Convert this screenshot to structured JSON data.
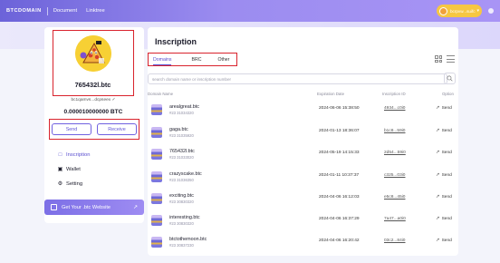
{
  "header": {
    "brand": "BTCDOMAIN",
    "nav": [
      "Document",
      "Linktree"
    ],
    "user_name": "bcrpvw...suifc"
  },
  "profile": {
    "name": "765432l.btc",
    "address": "bc1qamvs...dcpseex  ✓",
    "balance": "0.000010000000 BTC"
  },
  "actions": {
    "send_label": "Send",
    "receive_label": "Receive"
  },
  "menu": [
    {
      "label": "Inscription",
      "icon": "inscription-icon",
      "active": true
    },
    {
      "label": "Wallet",
      "icon": "wallet-icon",
      "active": false
    },
    {
      "label": "Setting",
      "icon": "gear-icon",
      "active": false
    }
  ],
  "cta": {
    "label": "Get Your .btc Website",
    "arrow": "↗"
  },
  "main": {
    "title": "Inscription",
    "tabs": [
      "Domains",
      "BRC",
      "Other"
    ],
    "active_tab": "Domains",
    "search_placeholder": "search domain name or inscription number",
    "columns": [
      "Domain Name",
      "Expiration Date",
      "Inscription ID",
      "Option"
    ],
    "rows": [
      {
        "name": "arealgreat.btc",
        "id": "#23 31034320",
        "date": "2024-06-06 15:38:50",
        "insc": "4934...c0i0",
        "action": "Send"
      },
      {
        "name": "gaga.btc",
        "id": "#23 31035920",
        "date": "2024-01-13 18:36:07",
        "insc": "b1c8...59i0",
        "action": "Send"
      },
      {
        "name": "765432l.btc",
        "id": "#23 31033020",
        "date": "2024-05-19 14:15:33",
        "insc": "2d54...59i0",
        "action": "Send"
      },
      {
        "name": "crazyscake.btc",
        "id": "#23 31036350",
        "date": "2024-01-11 10:37:37",
        "insc": "c325...03i0",
        "action": "Send"
      },
      {
        "name": "exciting.btc",
        "id": "#23 30830320",
        "date": "2024-04-06 16:12:03",
        "insc": "e5c8...45i0",
        "action": "Send"
      },
      {
        "name": "interesting.btc",
        "id": "#23 30830320",
        "date": "2024-04-06 16:37:29",
        "insc": "7a47...a0i0",
        "action": "Send"
      },
      {
        "name": "btctothemoon.btc",
        "id": "#23 30837230",
        "date": "2024-04-06 16:20:42",
        "insc": "03c2...84i0",
        "action": "Send"
      }
    ]
  },
  "colors": {
    "accent": "#6c63d9",
    "highlight_box": "#d9232d"
  }
}
